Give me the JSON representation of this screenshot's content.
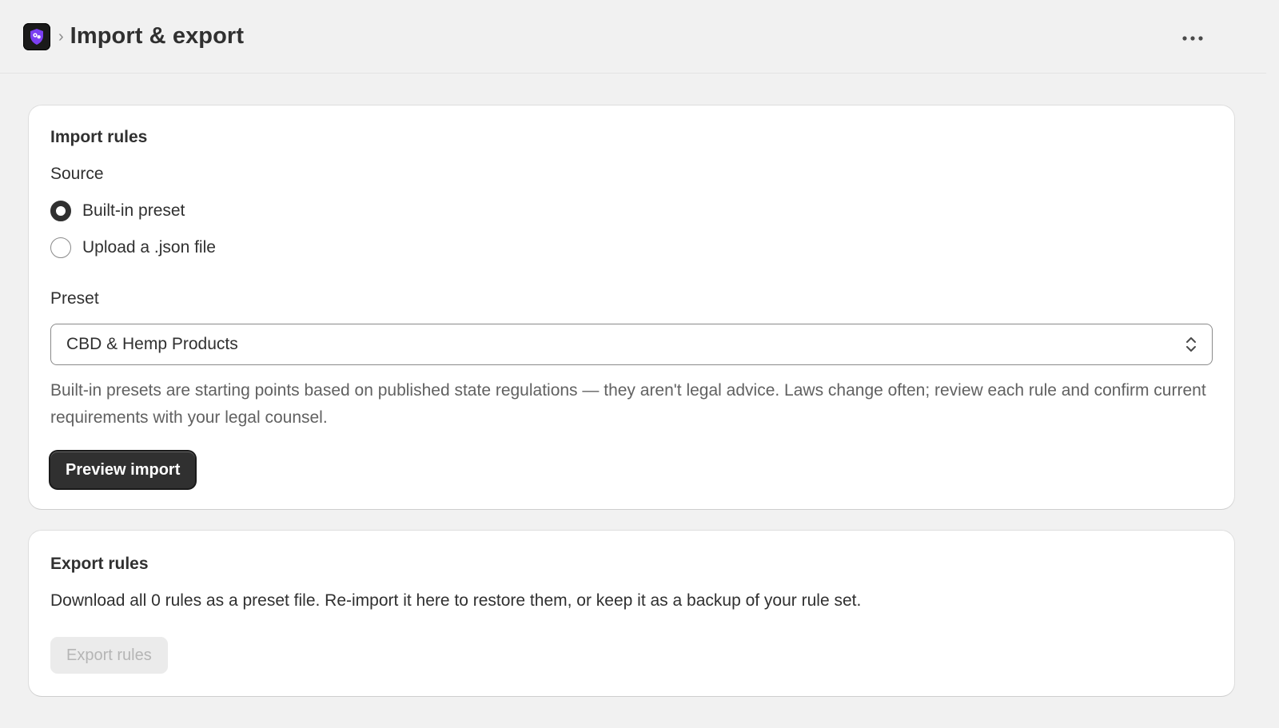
{
  "header": {
    "breadcrumb_separator": "›",
    "title": "Import & export",
    "more_icon": "more-horizontal-icon",
    "app_icon": "shield-app-icon",
    "app_icon_color": "#7b3ff2"
  },
  "import_card": {
    "title": "Import rules",
    "source_label": "Source",
    "options": [
      {
        "label": "Built-in preset",
        "checked": true
      },
      {
        "label": "Upload a .json file",
        "checked": false
      }
    ],
    "preset_label": "Preset",
    "preset_value": "CBD & Hemp Products",
    "help_text": "Built-in presets are starting points based on published state regulations — they aren't legal advice. Laws change often; review each rule and confirm current requirements with your legal counsel.",
    "preview_button": "Preview import"
  },
  "export_card": {
    "title": "Export rules",
    "description": "Download all 0 rules as a preset file. Re-import it here to restore them, or keep it as a backup of your rule set.",
    "export_button": "Export rules"
  }
}
